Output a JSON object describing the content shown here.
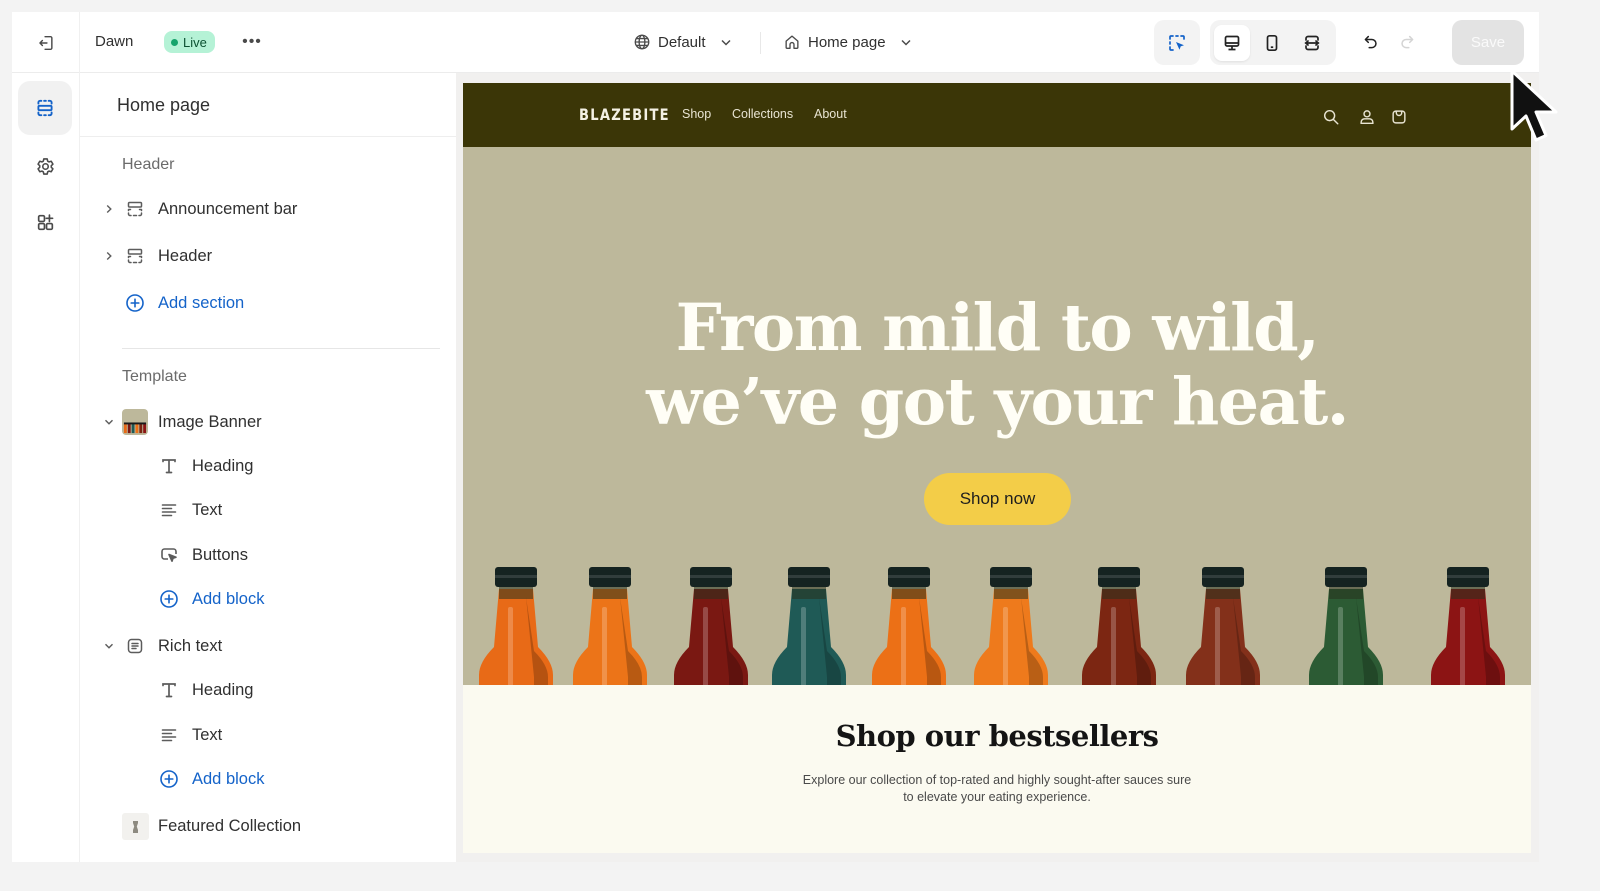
{
  "topbar": {
    "exit_icon": "exit-icon",
    "theme_name": "Dawn",
    "status_badge": "Live",
    "more_label": "•••",
    "market_select": {
      "icon": "globe-icon",
      "value": "Default"
    },
    "page_select": {
      "icon": "home-icon",
      "value": "Home page"
    },
    "inspector_icon": "inspect-cursor-icon",
    "view_modes": [
      {
        "name": "desktop",
        "icon": "desktop-icon",
        "active": true
      },
      {
        "name": "mobile",
        "icon": "mobile-icon",
        "active": false
      },
      {
        "name": "full-width",
        "icon": "fullwidth-icon",
        "active": false
      }
    ],
    "undo_icon": "undo-icon",
    "redo_icon": "redo-icon",
    "save_label": "Save"
  },
  "rail": {
    "items": [
      {
        "name": "sections",
        "icon": "sections-icon",
        "active": true
      },
      {
        "name": "theme-settings",
        "icon": "gear-icon",
        "active": false
      },
      {
        "name": "apps",
        "icon": "apps-add-icon",
        "active": false
      }
    ]
  },
  "panel": {
    "title": "Home page",
    "header_group": {
      "label": "Header",
      "items": [
        {
          "label": "Announcement bar",
          "icon": "section-layout-icon",
          "expandable": true
        },
        {
          "label": "Header",
          "icon": "section-layout-icon",
          "expandable": true
        }
      ],
      "add_label": "Add section"
    },
    "template_group": {
      "label": "Template",
      "sections": [
        {
          "label": "Image Banner",
          "icon": "image-thumbnail",
          "expanded": true,
          "blocks": [
            {
              "label": "Heading",
              "icon": "heading-icon"
            },
            {
              "label": "Text",
              "icon": "text-icon"
            },
            {
              "label": "Buttons",
              "icon": "button-icon"
            }
          ],
          "add_label": "Add block"
        },
        {
          "label": "Rich text",
          "icon": "rich-text-icon",
          "expanded": true,
          "blocks": [
            {
              "label": "Heading",
              "icon": "heading-icon"
            },
            {
              "label": "Text",
              "icon": "text-icon"
            }
          ],
          "add_label": "Add block"
        },
        {
          "label": "Featured Collection",
          "icon": "collection-thumbnail",
          "expanded": false
        }
      ],
      "add_label": "Add section"
    }
  },
  "preview": {
    "store": {
      "logo": "BLAZEBITE",
      "nav": [
        "Shop",
        "Collections",
        "About"
      ],
      "header_icons": [
        "search-icon",
        "account-icon",
        "cart-icon"
      ]
    },
    "hero": {
      "heading_line1": "From mild to wild,",
      "heading_line2": "we’ve got your heat.",
      "button_label": "Shop now",
      "bottle_colors": [
        "#e86a17",
        "#ec7418",
        "#7a1812",
        "#1f5a56",
        "#ec7016",
        "#ee7a1c",
        "#7c2612",
        "#83301a",
        "#2c5b34",
        "#8c1414"
      ]
    },
    "rich_text": {
      "heading": "Shop our bestsellers",
      "text": "Explore our collection of top-rated and highly sought-after sauces sure to elevate your eating experience."
    }
  },
  "colors": {
    "accent_blue": "#1463c9",
    "live_badge_bg": "#b5f2d6",
    "store_header_bg": "#3b3607",
    "hero_bg": "#bdb89b",
    "cta_yellow": "#f3cd48",
    "rich_text_bg": "#fbfaf0"
  }
}
